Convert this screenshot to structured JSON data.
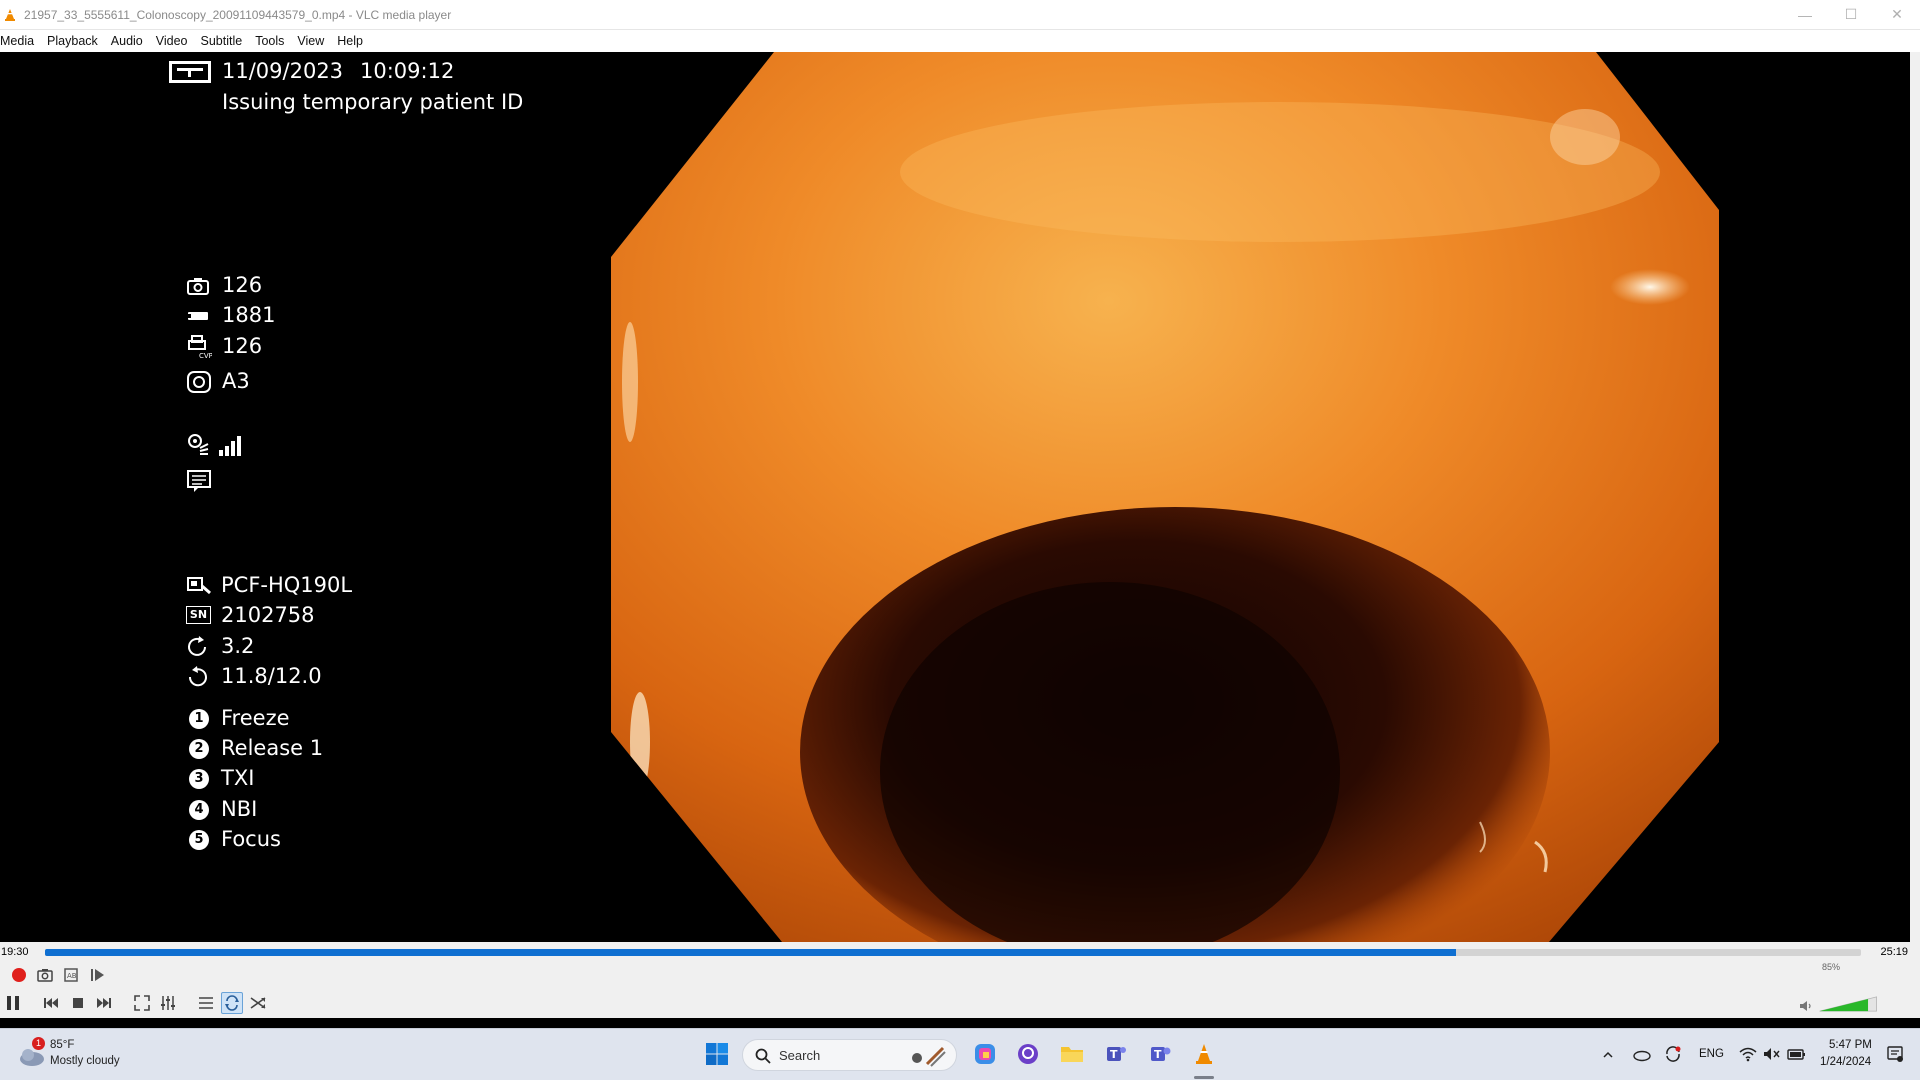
{
  "window": {
    "title": "21957_33_5555611_Colonoscopy_20091109443579_0.mp4 - VLC media player",
    "controls": {
      "minimize": "—",
      "maximize": "☐",
      "close": "✕"
    }
  },
  "menu": [
    "Media",
    "Playback",
    "Audio",
    "Video",
    "Subtitle",
    "Tools",
    "View",
    "Help"
  ],
  "overlay": {
    "date": "11/09/2023",
    "time": "10:09:12",
    "status": "Issuing temporary patient ID",
    "camera_count": "126",
    "bar_value": "1881",
    "cvp_value": "126",
    "mode": "A3",
    "scope_model": "PCF-HQ190L",
    "serial_label": "SN",
    "serial": "2102758",
    "rotation_value": "3.2",
    "ratio": "11.8/12.0",
    "buttons": [
      {
        "num": "1",
        "label": "Freeze"
      },
      {
        "num": "2",
        "label": "Release 1"
      },
      {
        "num": "3",
        "label": "TXI"
      },
      {
        "num": "4",
        "label": "NBI"
      },
      {
        "num": "5",
        "label": "Focus"
      }
    ]
  },
  "player": {
    "elapsed": "19:30",
    "total": "25:19",
    "progress": 0.777,
    "volume_pct": "85%",
    "volume": 0.85
  },
  "taskbar": {
    "weather_temp": "85°F",
    "weather_desc": "Mostly cloudy",
    "weather_badge": "1",
    "search_placeholder": "Search",
    "language": "ENG",
    "clock_time": "5:47 PM",
    "clock_date": "1/24/2024"
  },
  "colors": {
    "accent": "#0f6fd1",
    "record": "#e0201c",
    "tissue_light": "#f29a3a",
    "tissue_dark": "#c14f08"
  }
}
